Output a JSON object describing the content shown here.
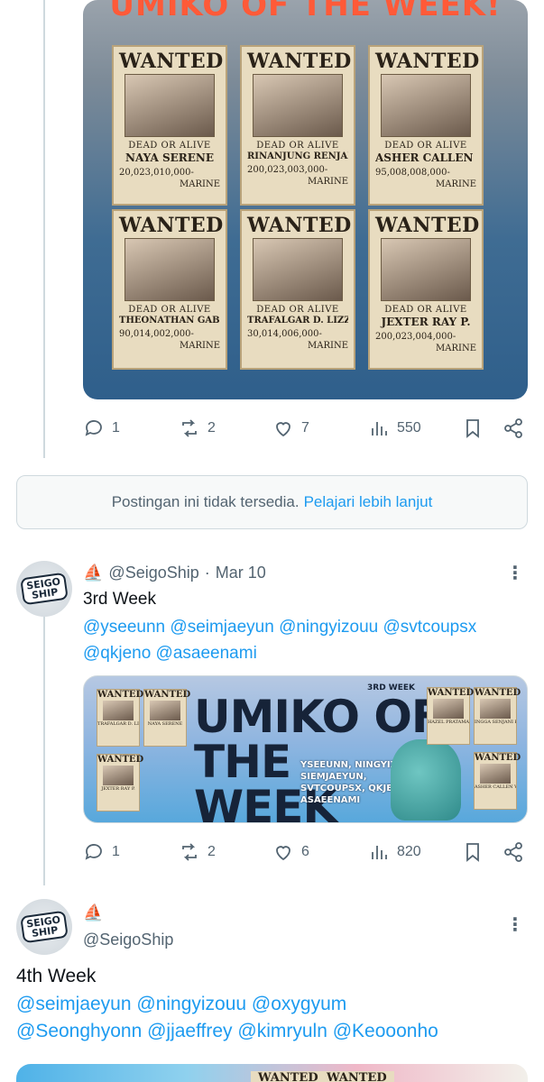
{
  "tweet1": {
    "banner_title": "UMIKO OF THE WEEK!",
    "posters": [
      {
        "title": "WANTED",
        "doa": "DEAD OR ALIVE",
        "name": "NAYA SERENE",
        "bounty": "20,023,010,000-",
        "marine": "MARINE"
      },
      {
        "title": "WANTED",
        "doa": "DEAD OR ALIVE",
        "name": "RINANJUNG RENJANA",
        "bounty": "200,023,003,000-",
        "marine": "MARINE"
      },
      {
        "title": "WANTED",
        "doa": "DEAD OR ALIVE",
        "name": "ASHER CALLEN V.",
        "bounty": "95,008,008,000-",
        "marine": "MARINE"
      },
      {
        "title": "WANTED",
        "doa": "DEAD OR ALIVE",
        "name": "THEONATHAN GABRIEL",
        "bounty": "90,014,002,000-",
        "marine": "MARINE"
      },
      {
        "title": "WANTED",
        "doa": "DEAD OR ALIVE",
        "name": "TRAFALGAR D. LIZZY",
        "bounty": "30,014,006,000-",
        "marine": "MARINE"
      },
      {
        "title": "WANTED",
        "doa": "DEAD OR ALIVE",
        "name": "JEXTER RAY P.",
        "bounty": "200,023,004,000-",
        "marine": "MARINE"
      }
    ],
    "actions": {
      "replies": "1",
      "reposts": "2",
      "likes": "7",
      "views": "550"
    }
  },
  "unavailable": {
    "text": "Postingan ini tidak tersedia.",
    "link": "Pelajari lebih lanjut"
  },
  "tweet2": {
    "avatar_logo_top": "SEIGO",
    "avatar_logo_bottom": "SHIP",
    "emoji": "⛵",
    "handle": "@SeigoShip",
    "separator": "·",
    "date": "Mar 10",
    "text": "3rd Week",
    "mentions_line1": "@yseeunn @seimjaeyun @ningyizouu @svtcoupsx",
    "mentions_line2": "@qkjeno @asaeenami",
    "banner": {
      "week_label": "3RD WEEK",
      "title_line1": "UMIKO OF THE",
      "title_line2": "WEEK",
      "names_line1": "YSEEUNN, NINGYIZOUU,",
      "names_line2": "SIEMJAEYUN,",
      "names_line3": "SVTCOUPSX, QKJENO,",
      "names_line4": "ASAEENAMI",
      "posters": [
        {
          "title": "WANTED",
          "name": "TRAFALGAR D. LIZZY"
        },
        {
          "title": "WANTED",
          "name": "NAYA SERENE"
        },
        {
          "title": "WANTED",
          "name": "JEXTER RAY P."
        },
        {
          "title": "WANTED",
          "name": "HAZEL PRATAMA"
        },
        {
          "title": "WANTED",
          "name": "INGGA SENJANI K."
        },
        {
          "title": "WANTED",
          "name": "ASHER CALLEN V."
        }
      ]
    },
    "actions": {
      "replies": "1",
      "reposts": "2",
      "likes": "6",
      "views": "820"
    }
  },
  "tweet3": {
    "avatar_logo_top": "SEIGO",
    "avatar_logo_bottom": "SHIP",
    "emoji": "⛵",
    "handle": "@SeigoShip",
    "text": "4th Week",
    "mentions_line1": "@seimjaeyun @ningyizouu @oxygyum",
    "mentions_line2": "@Seonghyonn @jjaeffrey @kimryuln @Keooonho",
    "peek_posters": [
      "WANTED",
      "WANTED"
    ]
  },
  "more_icon": "⋮",
  "colors": {
    "link": "#1d9bf0",
    "muted": "#536471",
    "border": "#cfd9de"
  }
}
